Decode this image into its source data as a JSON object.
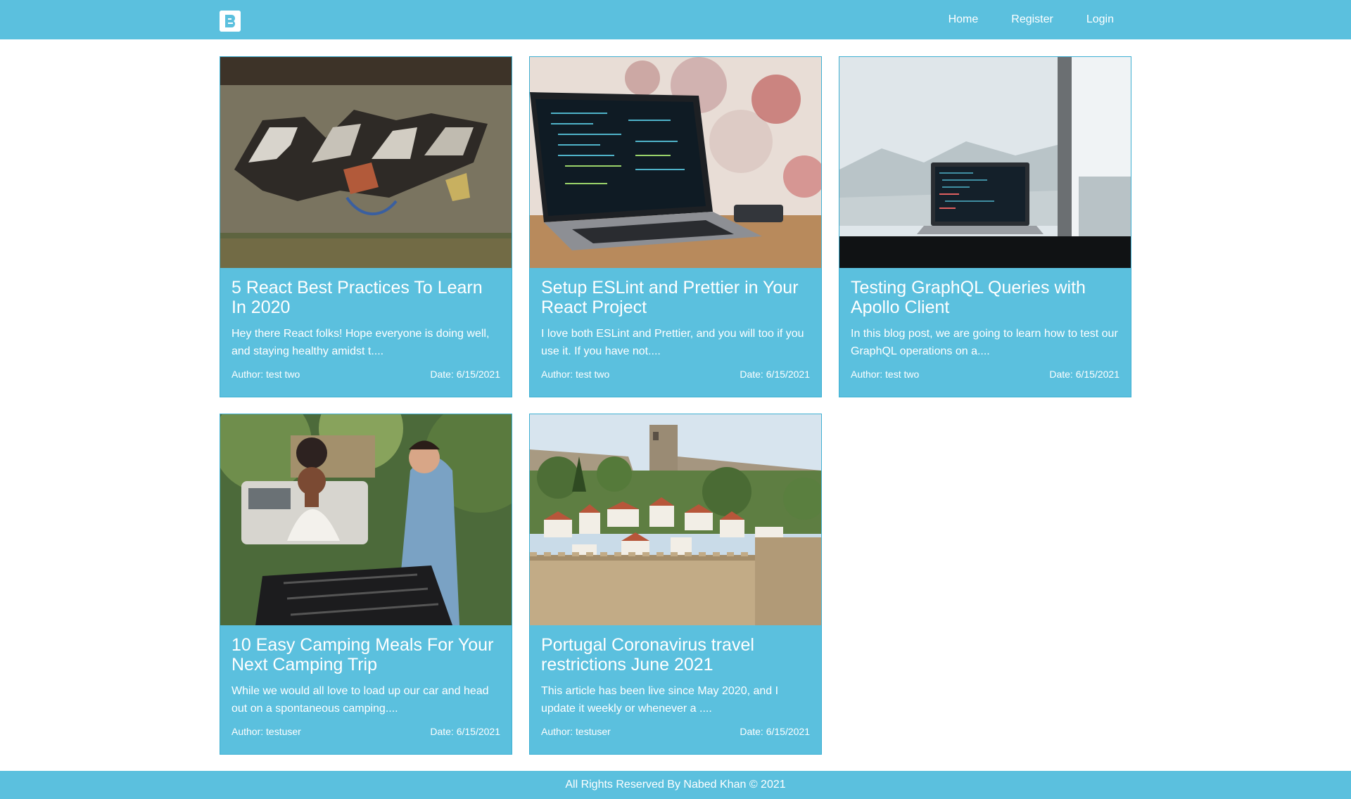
{
  "nav": {
    "logo_icon": "blogger-b-icon",
    "links": [
      "Home",
      "Register",
      "Login"
    ]
  },
  "posts": [
    {
      "image": "react-graffiti-wall",
      "title": "5 React Best Practices To Learn In 2020",
      "excerpt": "Hey there React folks! Hope everyone is doing well, and staying healthy amidst t....",
      "author": "Author: test two",
      "date": "Date: 6/15/2021"
    },
    {
      "image": "laptop-code-bokeh",
      "title": "Setup ESLint and Prettier in Your React Project",
      "excerpt": "I love both ESLint and Prettier, and you will too if you use it. If you have not....",
      "author": "Author: test two",
      "date": "Date: 6/15/2021"
    },
    {
      "image": "laptop-window",
      "title": "Testing GraphQL Queries with Apollo Client",
      "excerpt": "In this blog post, we are going to learn how to test our GraphQL operations on a....",
      "author": "Author: test two",
      "date": "Date: 6/15/2021"
    },
    {
      "image": "camping-cooking",
      "title": "10 Easy Camping Meals For Your Next Camping Trip",
      "excerpt": "While we would all love to load up our car and head out on a spontaneous camping....",
      "author": "Author: testuser",
      "date": "Date: 6/15/2021"
    },
    {
      "image": "portugal-castle-town",
      "title": "Portugal Coronavirus travel restrictions June 2021",
      "excerpt": "This article has been live since May 2020, and I update it weekly or whenever a ....",
      "author": "Author: testuser",
      "date": "Date: 6/15/2021"
    }
  ],
  "footer": {
    "text": "All Rights Reserved By Nabed Khan © 2021"
  },
  "colors": {
    "primary": "#5bc0de",
    "text": "#ffffff"
  }
}
